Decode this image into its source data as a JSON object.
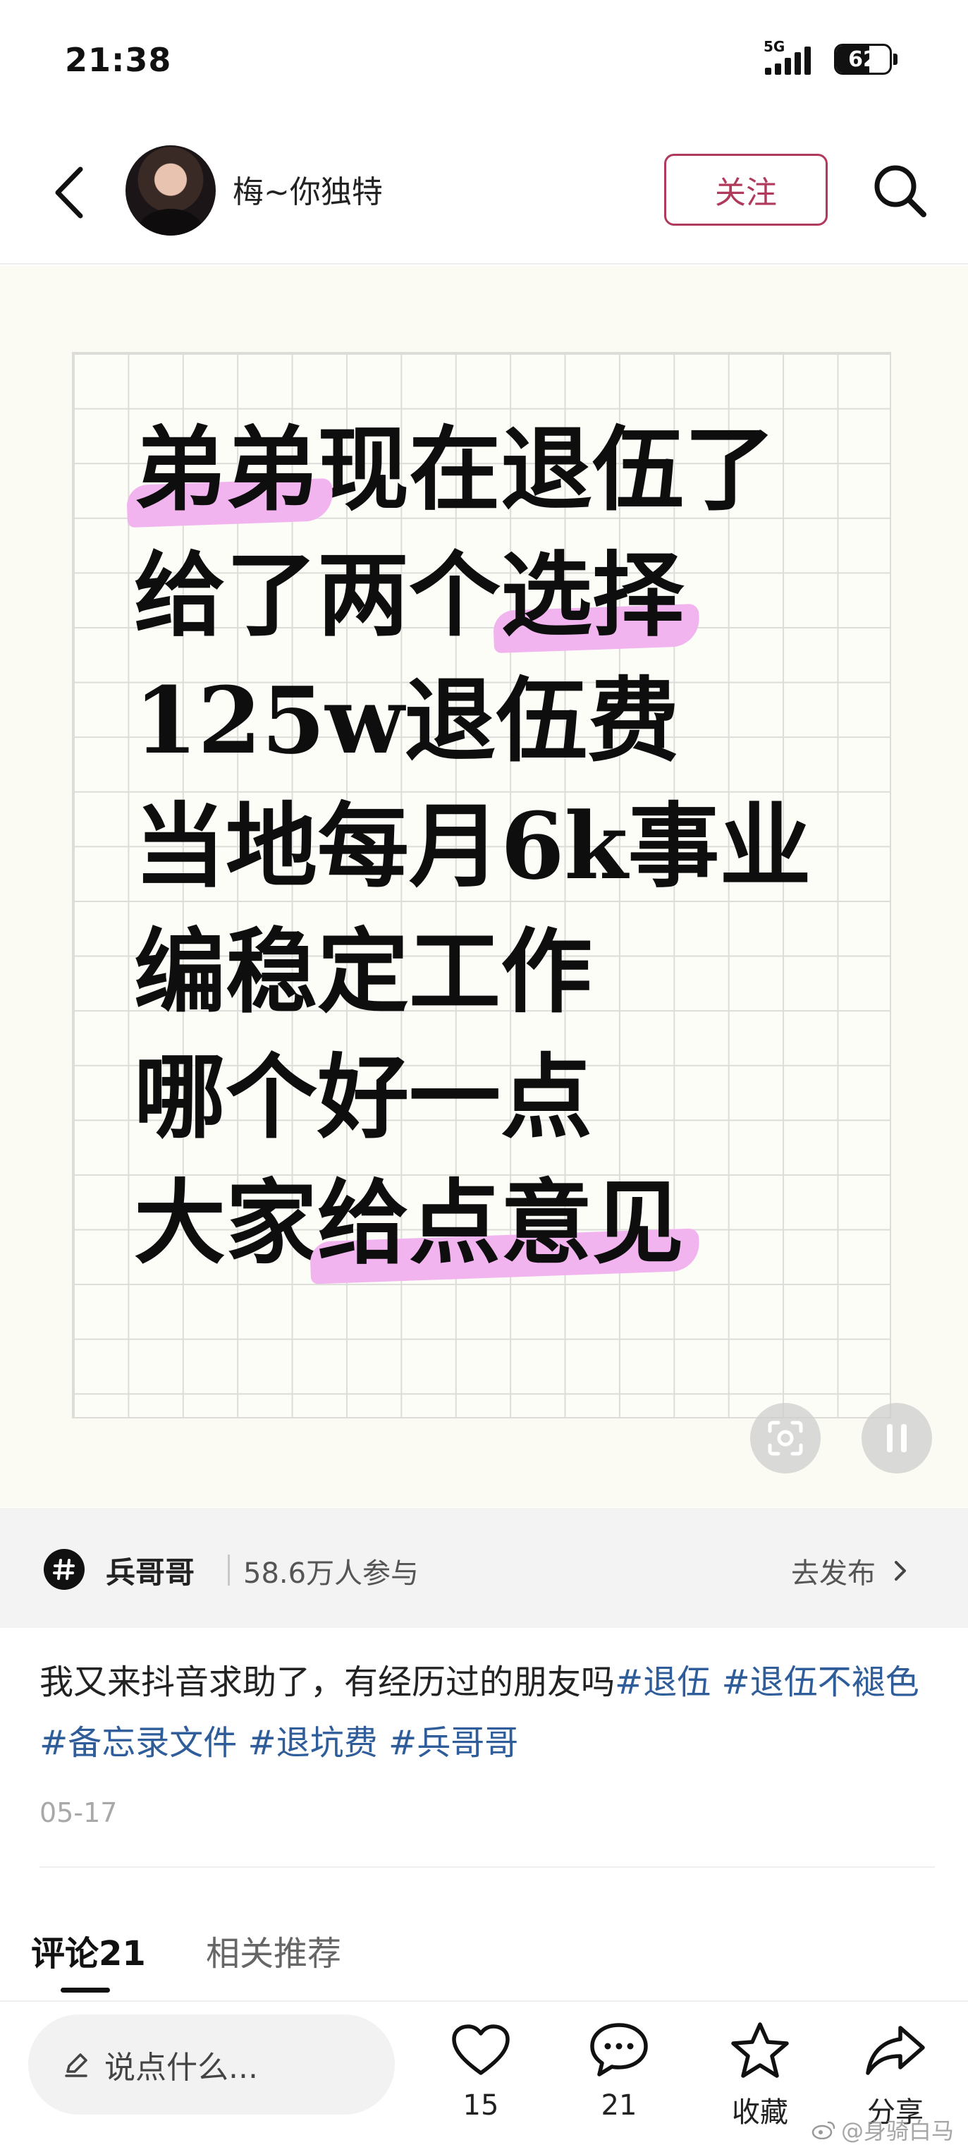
{
  "status_bar": {
    "time": "21:38",
    "network": "5G",
    "battery_level": "62"
  },
  "header": {
    "username": "梅~你独特",
    "follow_label": "关注"
  },
  "post_image": {
    "lines": [
      {
        "pre": "",
        "hl": "弟弟",
        "post": "现在退伍了"
      },
      {
        "pre": "给了两个",
        "hl": "选择",
        "post": ""
      },
      {
        "pre": "125w退伍费",
        "hl": "",
        "post": ""
      },
      {
        "pre": "当地每月6k事业",
        "hl": "",
        "post": ""
      },
      {
        "pre": "编稳定工作",
        "hl": "",
        "post": ""
      },
      {
        "pre": "哪个好一点",
        "hl": "",
        "post": ""
      },
      {
        "pre": "大家",
        "hl": "给点意见",
        "post": ""
      }
    ]
  },
  "topic": {
    "name": "兵哥哥",
    "participants": "58.6万人参与",
    "publish_label": "去发布"
  },
  "caption": {
    "text": "我又来抖音求助了，有经历过的朋友吗",
    "tags": [
      "#退伍",
      "#退伍不褪色",
      "#备忘录文件",
      "#退坑费",
      "#兵哥哥"
    ]
  },
  "post_date": "05-17",
  "tabs": {
    "comments": "评论21",
    "related": "相关推荐"
  },
  "bottom_bar": {
    "input_placeholder": "说点什么...",
    "likes": "15",
    "comments": "21",
    "favorite_label": "收藏",
    "share_label": "分享"
  },
  "watermark": "@身骑白马",
  "colors": {
    "accent": "#b03a5b",
    "tag": "#2f5d9a",
    "highlight": "#f2b4ef"
  }
}
